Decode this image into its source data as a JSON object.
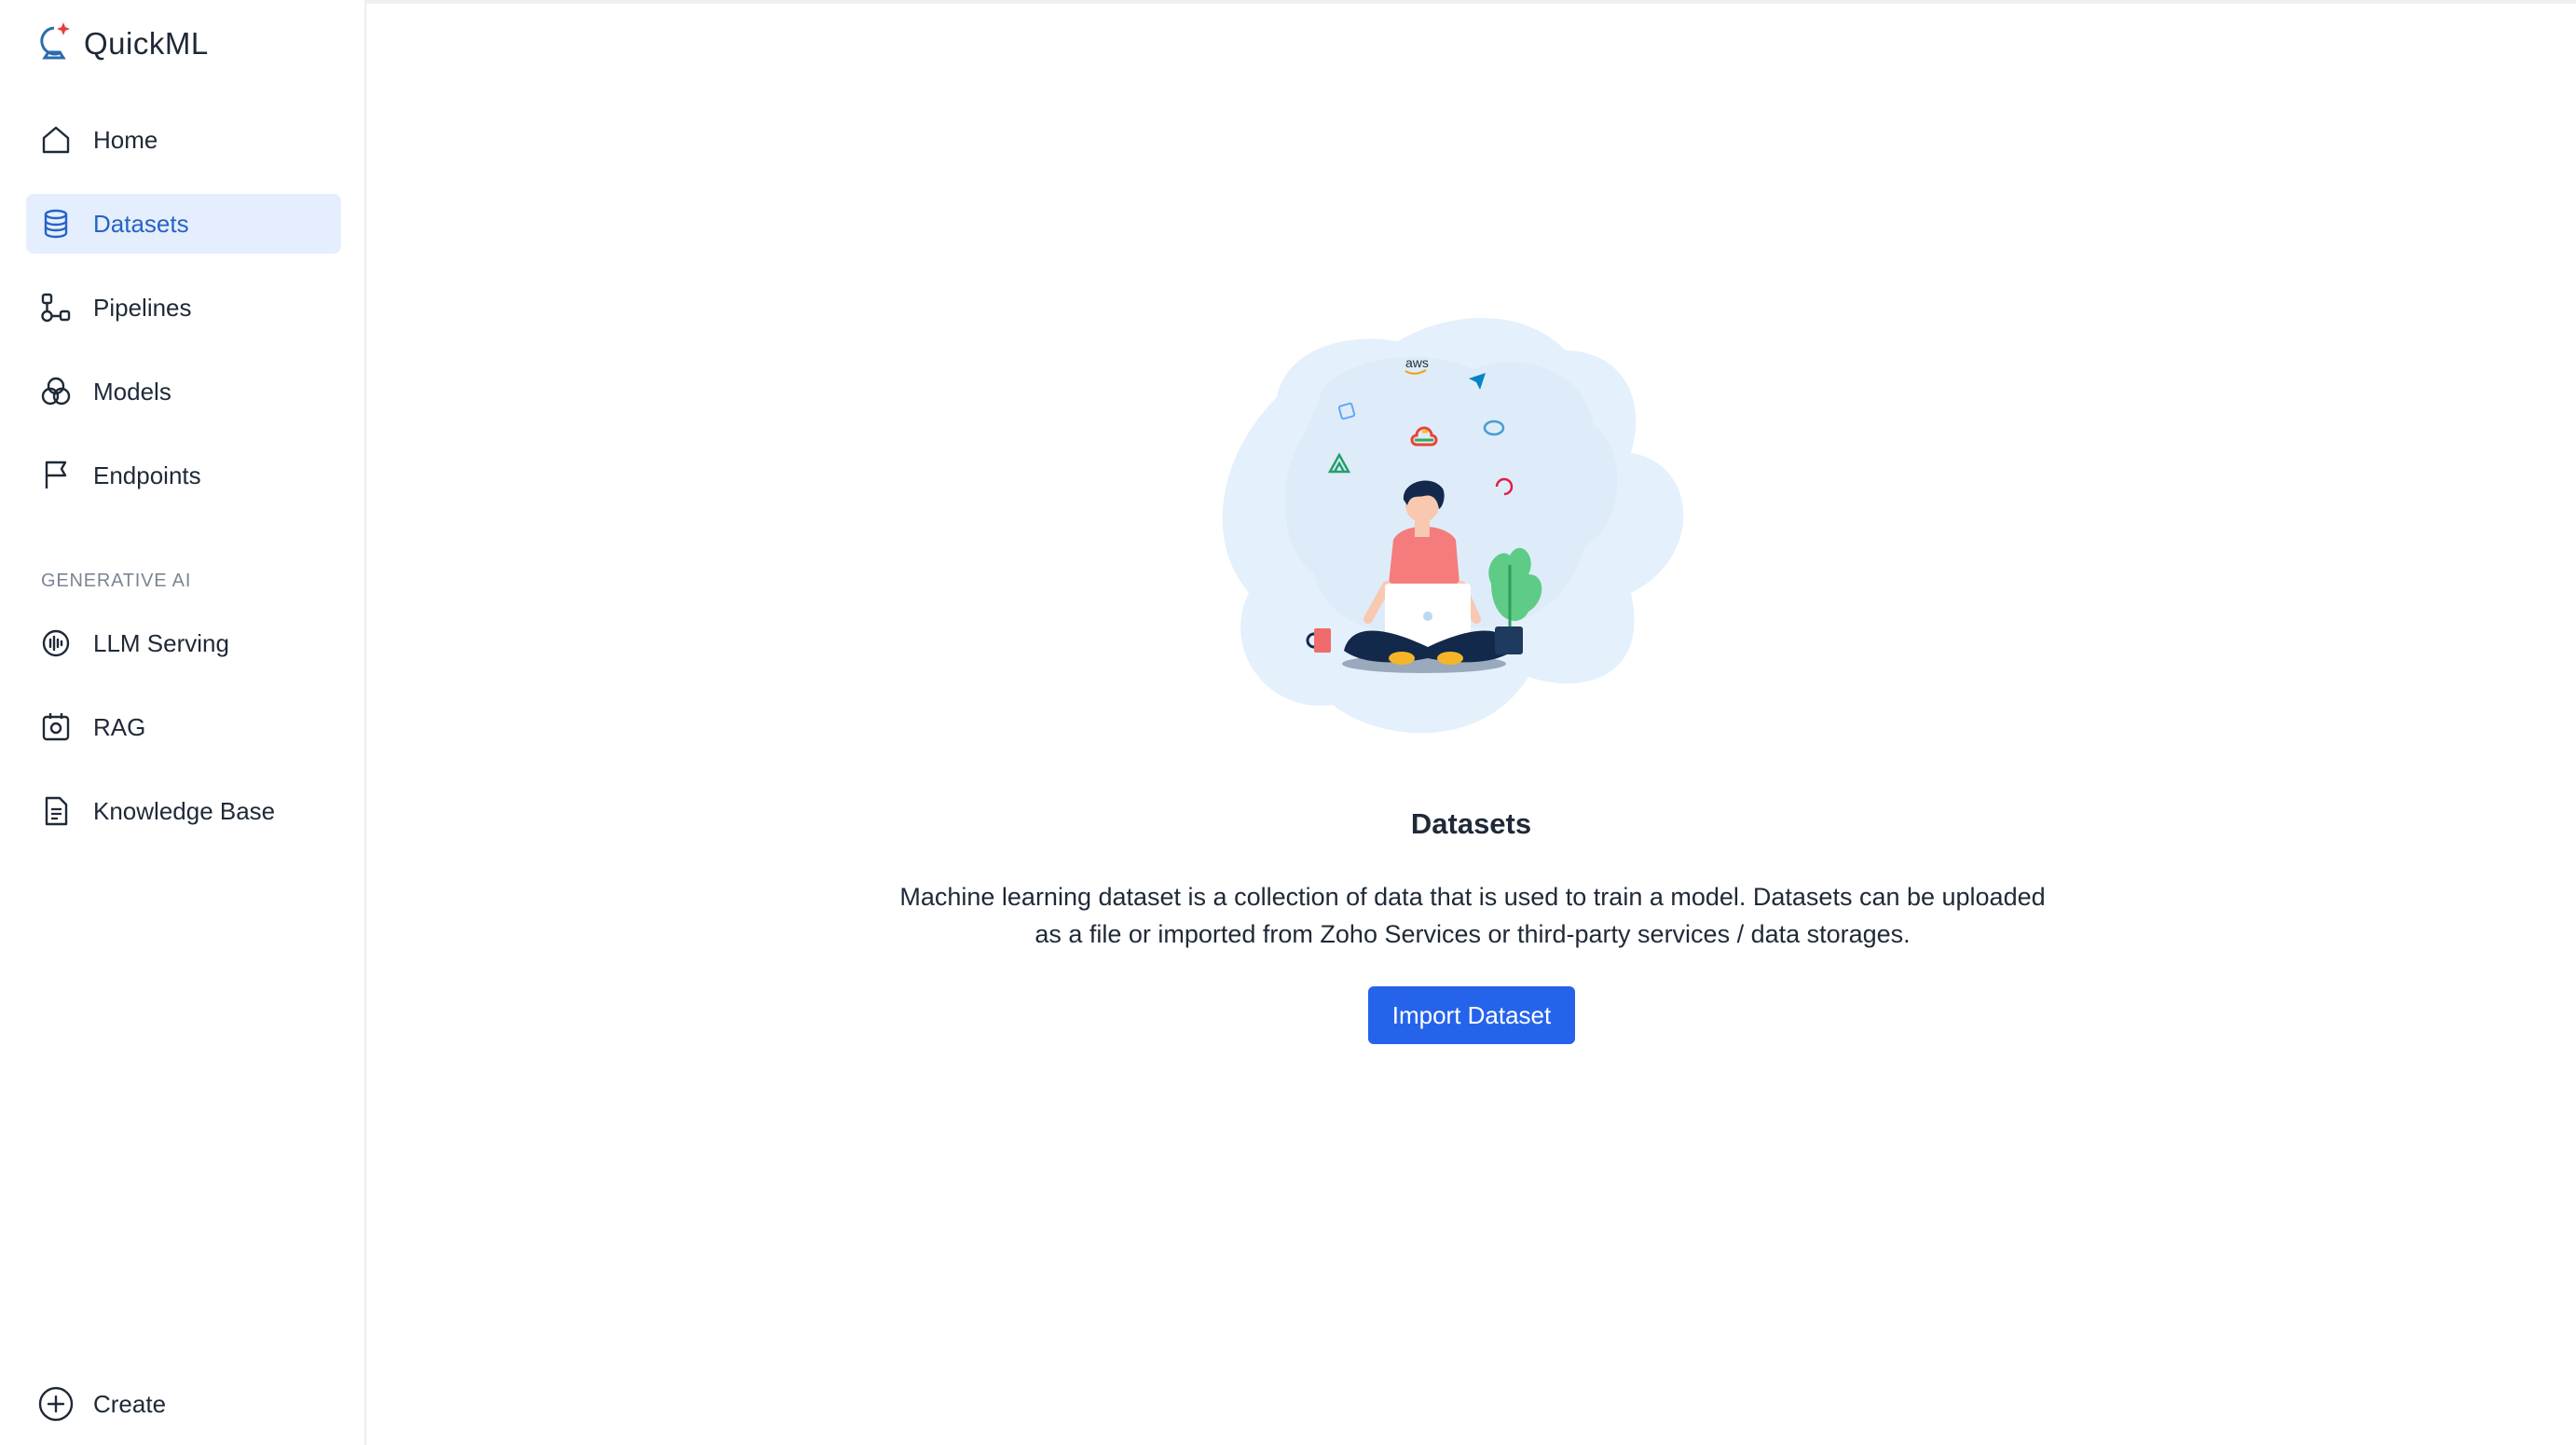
{
  "app": {
    "name": "QuickML"
  },
  "sidebar": {
    "items": [
      {
        "label": "Home",
        "icon": "home-icon",
        "active": false
      },
      {
        "label": "Datasets",
        "icon": "database-icon",
        "active": true
      },
      {
        "label": "Pipelines",
        "icon": "pipeline-icon",
        "active": false
      },
      {
        "label": "Models",
        "icon": "models-icon",
        "active": false
      },
      {
        "label": "Endpoints",
        "icon": "flag-icon",
        "active": false
      }
    ],
    "section_label": "GENERATIVE AI",
    "gen_items": [
      {
        "label": "LLM Serving",
        "icon": "llm-icon"
      },
      {
        "label": "RAG",
        "icon": "rag-icon"
      },
      {
        "label": "Knowledge Base",
        "icon": "document-icon"
      }
    ],
    "create_label": "Create"
  },
  "main": {
    "illustration_text": "aws",
    "title": "Datasets",
    "description": "Machine learning dataset is a collection of data that is used to train a model. Datasets can be uploaded as a file or imported from Zoho Services or third-party services / data storages.",
    "import_button": "Import Dataset"
  },
  "colors": {
    "accent": "#2563eb",
    "active_bg": "#e5eefc",
    "active_text": "#2563c9",
    "text": "#1f2937",
    "muted": "#7b8594"
  }
}
